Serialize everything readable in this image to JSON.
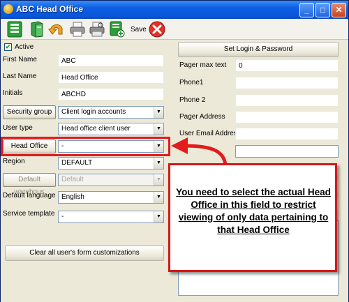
{
  "window": {
    "title": "ABC  Head Office"
  },
  "toolbar": {
    "save_label": "Save",
    "icons": [
      "save-green-icon",
      "book-icon",
      "undo-icon",
      "printer-icon",
      "print-preview-icon",
      "add-record-icon",
      "delete-icon"
    ]
  },
  "left": {
    "active_label": "Active",
    "active_checked": true,
    "first_name_label": "First Name",
    "first_name_value": "ABC",
    "last_name_label": "Last Name",
    "last_name_value": "Head Office",
    "initials_label": "Initials",
    "initials_value": "ABCHD",
    "security_group_label": "Security group",
    "security_group_value": "Client login accounts",
    "user_type_label": "User type",
    "user_type_value": "Head office client user",
    "head_office_label": "Head Office",
    "head_office_value": "-",
    "region_label": "Region",
    "region_value": "DEFAULT",
    "default_warehouse_label": "Default warehous",
    "default_warehouse_value": "Default",
    "default_language_label": "Default language",
    "default_language_value": "English",
    "service_template_label": "Service template",
    "service_template_value": "-",
    "clear_button": "Clear all user's  form customizations"
  },
  "right": {
    "set_login_button": "Set Login & Password",
    "pager_max_text_label": "Pager max text",
    "pager_max_text_value": "0",
    "phone1_label": "Phone1",
    "phone2_label": "Phone 2",
    "pager_address_label": "Pager Address",
    "user_email_label": "User Email Address"
  },
  "callout": {
    "text": "You need to select the actual Head Office in this field to restrict viewing of only data pertaining to that Head Office",
    "border_color": "#d61717"
  }
}
